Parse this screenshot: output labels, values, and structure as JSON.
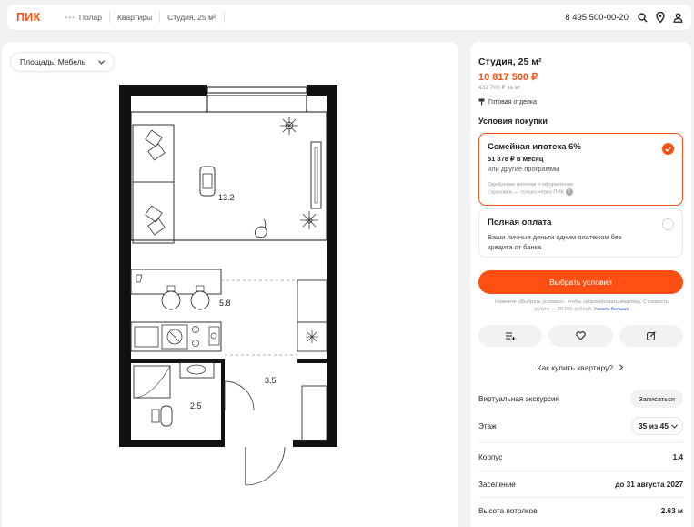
{
  "header": {
    "logo": "ПИК",
    "dots": "•••",
    "breadcrumbs": [
      "Полар",
      "Квартиры",
      "Студия, 25 м²"
    ],
    "phone": "8 495 500-00-20"
  },
  "plan": {
    "filter_label": "Площадь, Мебель",
    "rooms": [
      {
        "area": "13.2"
      },
      {
        "area": "5.8"
      },
      {
        "area": "3.5"
      },
      {
        "area": "2.5"
      }
    ]
  },
  "apartment": {
    "title": "Студия, 25 м²",
    "price": "10 817 500 ₽",
    "price_per_m2": "432 700 ₽ за м²",
    "finish": "Готовая отделка",
    "conditions_title": "Условия покупки"
  },
  "options": [
    {
      "title": "Семейная ипотека 6%",
      "subtitle": "51 878 ₽ в месяц",
      "subtitle2": "или другие программы",
      "note": "Одобрение ипотеки и оформление страховки — только через ПИК",
      "selected": true
    },
    {
      "title": "Полная оплата",
      "subtitle2": "Ваши личные деньги одним платежом без кредита от банка",
      "selected": false
    }
  ],
  "cta": {
    "label": "Выбрать условия",
    "note": "Нажмите «Выбрать условия», чтобы забронировать квартиру. Стоимость услуги — 20 000 рублей.",
    "link": "Узнать больше"
  },
  "how_to_buy": "Как купить квартиру?",
  "details": {
    "tour_label": "Виртуальная экскурсия",
    "tour_button": "Записаться",
    "floor_label": "Этаж",
    "floor_value": "35 из 45",
    "building_label": "Корпус",
    "building_value": "1.4",
    "move_in_label": "Заселение",
    "move_in_value": "до 31 августа 2027",
    "ceiling_label": "Высота потолков",
    "ceiling_value": "2.63 м"
  },
  "colors": {
    "accent": "#ff4f12",
    "link": "#3b64d9"
  }
}
